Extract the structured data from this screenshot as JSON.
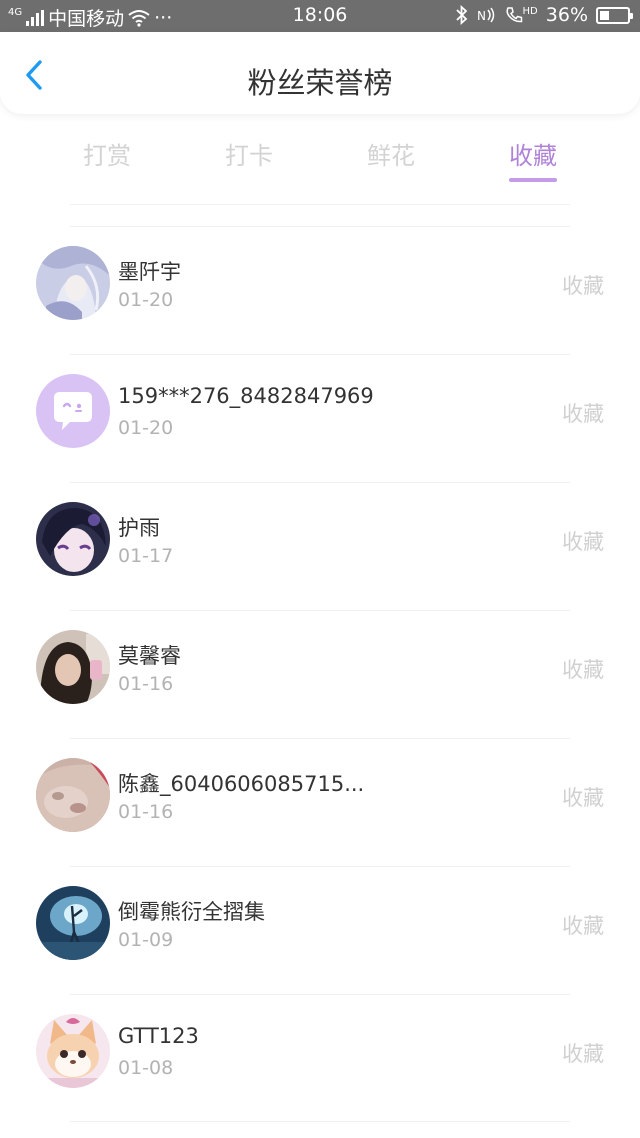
{
  "status_bar": {
    "network_type": "4G",
    "carrier": "中国移动",
    "more": "···",
    "time": "18:06",
    "hd_label": "HD",
    "battery": "36%",
    "battery_level": 0.36
  },
  "header": {
    "title": "粉丝荣誉榜",
    "back_icon": "chevron-left-icon"
  },
  "tabs": [
    {
      "label": "打赏",
      "active": false
    },
    {
      "label": "打卡",
      "active": false
    },
    {
      "label": "鲜花",
      "active": false
    },
    {
      "label": "收藏",
      "active": true
    }
  ],
  "colors": {
    "accent": "#b083d9",
    "underline": "#c39be6",
    "status_bar_bg": "#6e6e6e"
  },
  "fans": [
    {
      "name": "墨阡宇",
      "date": "01-20",
      "action": "收藏",
      "avatar": "anime-white-hair-avatar"
    },
    {
      "name": "159***276_8482847969",
      "date": "01-20",
      "action": "收藏",
      "avatar": "default-chat-bubble-avatar"
    },
    {
      "name": "护雨",
      "date": "01-17",
      "action": "收藏",
      "avatar": "anime-dark-hair-avatar"
    },
    {
      "name": "莫馨睿",
      "date": "01-16",
      "action": "收藏",
      "avatar": "girl-photo-avatar"
    },
    {
      "name": "陈鑫_6040606085715...",
      "date": "01-16",
      "action": "收藏",
      "avatar": "pink-blurry-avatar"
    },
    {
      "name": "倒霉熊衍全摺集",
      "date": "01-09",
      "action": "收藏",
      "avatar": "blue-scene-avatar"
    },
    {
      "name": "GTT123",
      "date": "01-08",
      "action": "收藏",
      "avatar": "fox-plush-avatar"
    }
  ]
}
